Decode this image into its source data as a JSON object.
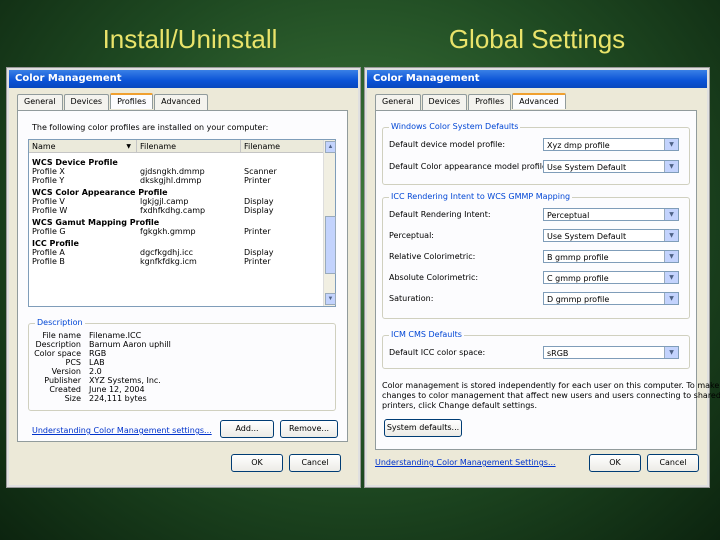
{
  "slide": {
    "left_title": "Install/Uninstall",
    "right_title": "Global Settings"
  },
  "left_dialog": {
    "title": "Color Management",
    "tabs": [
      "General",
      "Devices",
      "Profiles",
      "Advanced"
    ],
    "active_tab": "Profiles",
    "intro": "The following color profiles are installed on your computer:",
    "columns": [
      "Name",
      "Filename",
      "Filename"
    ],
    "groups": [
      {
        "heading": "WCS Device Profile",
        "rows": [
          [
            "Profile X",
            "gjdsngkh.dmmp",
            "Scanner"
          ],
          [
            "Profile Y",
            "dkskgjhl.dmmp",
            "Printer"
          ]
        ]
      },
      {
        "heading": "WCS Color Appearance Profile",
        "rows": [
          [
            "Profile V",
            "lgkjgjl.camp",
            "Display"
          ],
          [
            "Profile W",
            "fxdhfkdhg.camp",
            "Display"
          ]
        ]
      },
      {
        "heading": "WCS Gamut Mapping Profile",
        "rows": [
          [
            "Profile G",
            "fgkgkh.gmmp",
            "Printer"
          ]
        ]
      },
      {
        "heading": "ICC Profile",
        "rows": [
          [
            "Profile A",
            "dgcfkgdhj.icc",
            "Display"
          ],
          [
            "Profile B",
            "kgnfkfdkg.icm",
            "Printer"
          ]
        ]
      }
    ],
    "description": {
      "label": "Description",
      "fields": [
        [
          "File name",
          "Filename.ICC"
        ],
        [
          "Description",
          "Barnum Aaron uphill"
        ],
        [
          "Color space",
          "RGB"
        ],
        [
          "PCS",
          "LAB"
        ],
        [
          "Version",
          "2.0"
        ],
        [
          "Publisher",
          "XYZ Systems, Inc."
        ],
        [
          "Created",
          "June 12, 2004"
        ],
        [
          "Size",
          "224,111 bytes"
        ]
      ]
    },
    "link": "Understanding Color Management settings...",
    "add_button": "Add...",
    "remove_button": "Remove...",
    "ok_button": "OK",
    "cancel_button": "Cancel"
  },
  "right_dialog": {
    "title": "Color Management",
    "tabs": [
      "General",
      "Devices",
      "Profiles",
      "Advanced"
    ],
    "active_tab": "Advanced",
    "wcs_group": {
      "label": "Windows Color System Defaults",
      "rows": [
        {
          "label": "Default device model profile:",
          "value": "Xyz dmp profile"
        },
        {
          "label": "Default Color appearance model profile:",
          "value": "Use System Default"
        }
      ]
    },
    "icc_group": {
      "label": "ICC Rendering Intent to WCS GMMP Mapping",
      "rows": [
        {
          "label": "Default Rendering Intent:",
          "value": "Perceptual"
        },
        {
          "label": "Perceptual:",
          "value": "Use System Default"
        },
        {
          "label": "Relative Colorimetric:",
          "value": "B gmmp profile"
        },
        {
          "label": "Absolute Colorimetric:",
          "value": "C gmmp profile"
        },
        {
          "label": "Saturation:",
          "value": "D gmmp profile"
        }
      ]
    },
    "cms_group": {
      "label": "ICM CMS Defaults",
      "rows": [
        {
          "label": "Default ICC color space:",
          "value": "sRGB"
        }
      ]
    },
    "note": [
      "Color management is stored independently for each user on this computer. To make",
      "changes to color management that affect new users and users connecting to shared",
      "printers, click Change default settings."
    ],
    "system_defaults_button": "System defaults...",
    "link": "Understanding Color Management Settings...",
    "ok_button": "OK",
    "cancel_button": "Cancel"
  }
}
